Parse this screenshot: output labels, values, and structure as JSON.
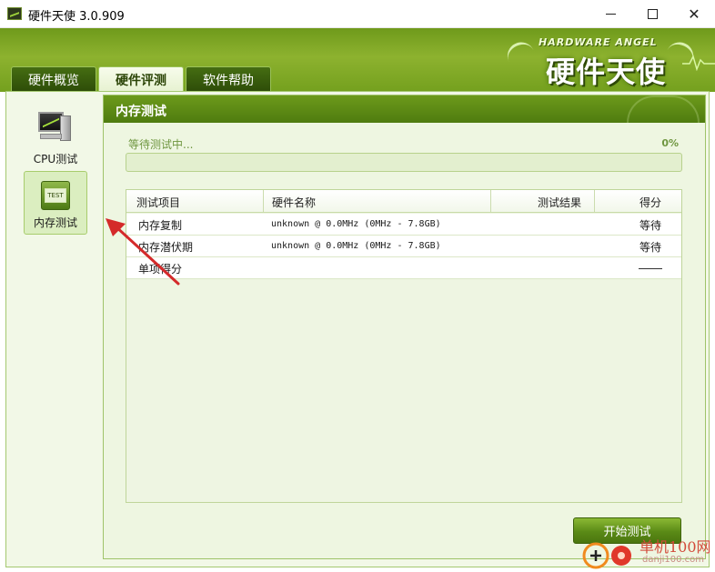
{
  "window": {
    "title": "硬件天使 3.0.909",
    "minimize_label": "",
    "maximize_label": "",
    "close_label": "✕"
  },
  "header": {
    "logo_en": "HARDWARE ANGEL",
    "logo_cn": "硬件天使"
  },
  "tabs": [
    {
      "label": "硬件概览",
      "active": false
    },
    {
      "label": "硬件评测",
      "active": true
    },
    {
      "label": "软件帮助",
      "active": false
    }
  ],
  "left_nav": [
    {
      "label": "CPU测试",
      "icon": "cpu-monitor-icon",
      "selected": false
    },
    {
      "label": "内存测试",
      "icon": "test-chip-icon",
      "icon_text": "TEST",
      "selected": true
    }
  ],
  "panel": {
    "title": "内存测试",
    "progress_label": "等待测试中...",
    "progress_percent_text": "0%",
    "progress_fraction": 0
  },
  "table": {
    "columns": [
      "测试项目",
      "硬件名称",
      "测试结果",
      "得分"
    ],
    "rows": [
      {
        "item": "内存复制",
        "hardware": "unknown @ 0.0MHz (0MHz - 7.8GB)",
        "result": "",
        "score": "等待"
      },
      {
        "item": "内存潜伏期",
        "hardware": "unknown @ 0.0MHz (0MHz - 7.8GB)",
        "result": "",
        "score": "等待"
      },
      {
        "item": "单项得分",
        "hardware": "",
        "result": "",
        "score": ""
      }
    ]
  },
  "buttons": {
    "start_test": "开始测试"
  },
  "watermark": {
    "site_name": "单机100网",
    "site_url": "danji100.com"
  },
  "colors": {
    "accent_green": "#5a8a16",
    "header_green": "#8db22f",
    "arrow_red": "#d42a2a"
  }
}
